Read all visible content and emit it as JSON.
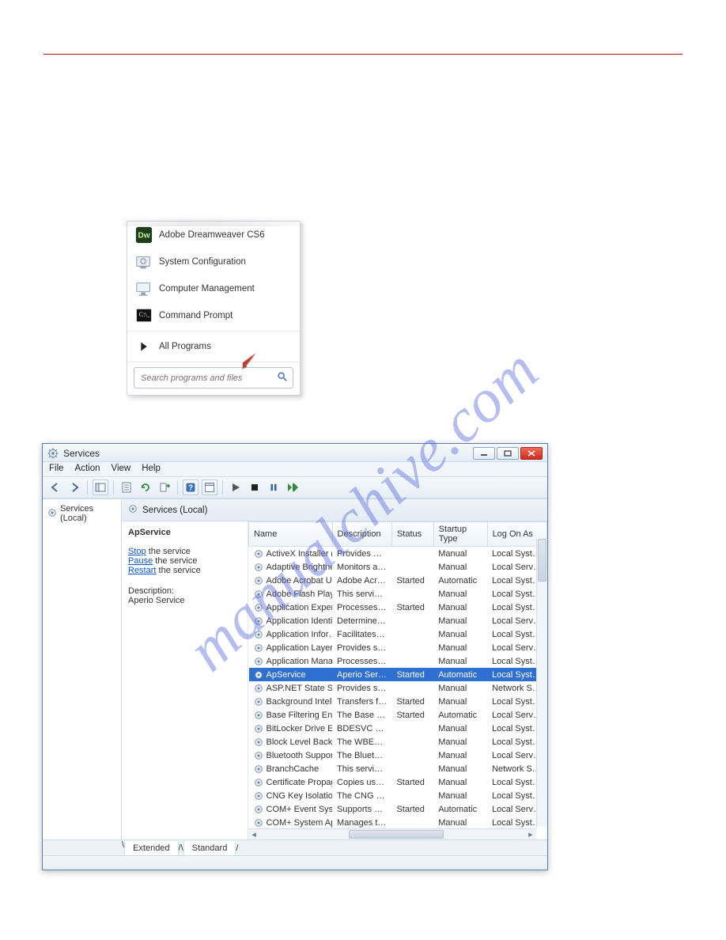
{
  "watermark": "manualchive.com",
  "startmenu": {
    "items": [
      {
        "label": "Adobe Dreamweaver CS6"
      },
      {
        "label": "System Configuration"
      },
      {
        "label": "Computer Management"
      },
      {
        "label": "Command Prompt"
      },
      {
        "label": "All Programs"
      }
    ],
    "search_placeholder": "Search programs and files"
  },
  "services_window": {
    "title": "Services",
    "menu": [
      "File",
      "Action",
      "View",
      "Help"
    ],
    "tree_label": "Services (Local)",
    "header_label": "Services (Local)",
    "detail": {
      "name": "ApService",
      "links": {
        "stop": "Stop",
        "pause": "Pause",
        "restart": "Restart"
      },
      "link_suffix": " the service",
      "desc_heading": "Description:",
      "desc": "Aperio Service"
    },
    "columns": [
      "Name",
      "Description",
      "Status",
      "Startup Type",
      "Log On As"
    ],
    "rows": [
      {
        "name": "ActiveX Installer (…",
        "desc": "Provides Us…",
        "status": "",
        "startup": "Manual",
        "logon": "Local Syste…"
      },
      {
        "name": "Adaptive Brightness",
        "desc": "Monitors a…",
        "status": "",
        "startup": "Manual",
        "logon": "Local Service"
      },
      {
        "name": "Adobe Acrobat U…",
        "desc": "Adobe Acro…",
        "status": "Started",
        "startup": "Automatic",
        "logon": "Local Syste…"
      },
      {
        "name": "Adobe Flash Playe…",
        "desc": "This service …",
        "status": "",
        "startup": "Manual",
        "logon": "Local Syste…"
      },
      {
        "name": "Application Experi…",
        "desc": "Processes a…",
        "status": "Started",
        "startup": "Manual",
        "logon": "Local Syste…"
      },
      {
        "name": "Application Identity",
        "desc": "Determines …",
        "status": "",
        "startup": "Manual",
        "logon": "Local Service"
      },
      {
        "name": "Application Infor…",
        "desc": "Facilitates t…",
        "status": "",
        "startup": "Manual",
        "logon": "Local Syste…"
      },
      {
        "name": "Application Layer …",
        "desc": "Provides su…",
        "status": "",
        "startup": "Manual",
        "logon": "Local Service"
      },
      {
        "name": "Application Mana…",
        "desc": "Processes in…",
        "status": "",
        "startup": "Manual",
        "logon": "Local Syste…"
      },
      {
        "name": "ApService",
        "desc": "Aperio Servi…",
        "status": "Started",
        "startup": "Automatic",
        "logon": "Local Syste…",
        "selected": true
      },
      {
        "name": "ASP.NET State Ser…",
        "desc": "Provides su…",
        "status": "",
        "startup": "Manual",
        "logon": "Network S…"
      },
      {
        "name": "Background Intelli…",
        "desc": "Transfers fil…",
        "status": "Started",
        "startup": "Manual",
        "logon": "Local Syste…"
      },
      {
        "name": "Base Filtering Engi…",
        "desc": "The Base Fil…",
        "status": "Started",
        "startup": "Automatic",
        "logon": "Local Service"
      },
      {
        "name": "BitLocker Drive En…",
        "desc": "BDESVC hos…",
        "status": "",
        "startup": "Manual",
        "logon": "Local Syste…"
      },
      {
        "name": "Block Level Backu…",
        "desc": "The WBENG…",
        "status": "",
        "startup": "Manual",
        "logon": "Local Syste…"
      },
      {
        "name": "Bluetooth Support…",
        "desc": "The Bluetoo…",
        "status": "",
        "startup": "Manual",
        "logon": "Local Service"
      },
      {
        "name": "BranchCache",
        "desc": "This service …",
        "status": "",
        "startup": "Manual",
        "logon": "Network S…"
      },
      {
        "name": "Certificate Propag…",
        "desc": "Copies user …",
        "status": "Started",
        "startup": "Manual",
        "logon": "Local Syste…"
      },
      {
        "name": "CNG Key Isolation",
        "desc": "The CNG ke…",
        "status": "",
        "startup": "Manual",
        "logon": "Local Syste…"
      },
      {
        "name": "COM+ Event Syst…",
        "desc": "Supports Sy…",
        "status": "Started",
        "startup": "Automatic",
        "logon": "Local Service"
      },
      {
        "name": "COM+ System Ap…",
        "desc": "Manages th…",
        "status": "",
        "startup": "Manual",
        "logon": "Local Syste…"
      }
    ],
    "tabs": [
      "Extended",
      "Standard"
    ]
  }
}
